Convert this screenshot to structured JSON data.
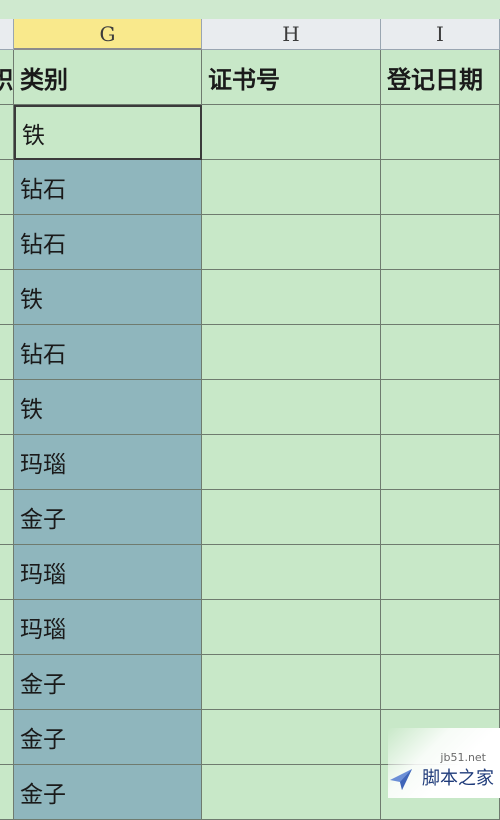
{
  "columns": {
    "g": "G",
    "h": "H",
    "i": "I"
  },
  "headers": {
    "f_partial": "积",
    "g": "类别",
    "h": "证书号",
    "i": "登记日期"
  },
  "category_values": [
    "铁",
    "钻石",
    "钻石",
    "铁",
    "钻石",
    "铁",
    "玛瑙",
    "金子",
    "玛瑙",
    "玛瑙",
    "金子",
    "金子",
    "金子"
  ],
  "selection": {
    "active_column": "G",
    "first_cell": "铁"
  },
  "colors": {
    "sheet_bg": "#c8e8c8",
    "selection_fill": "#8fb6bd",
    "active_header": "#f9e98c"
  },
  "watermark": {
    "url": "jb51.net",
    "name": "脚本之家"
  }
}
